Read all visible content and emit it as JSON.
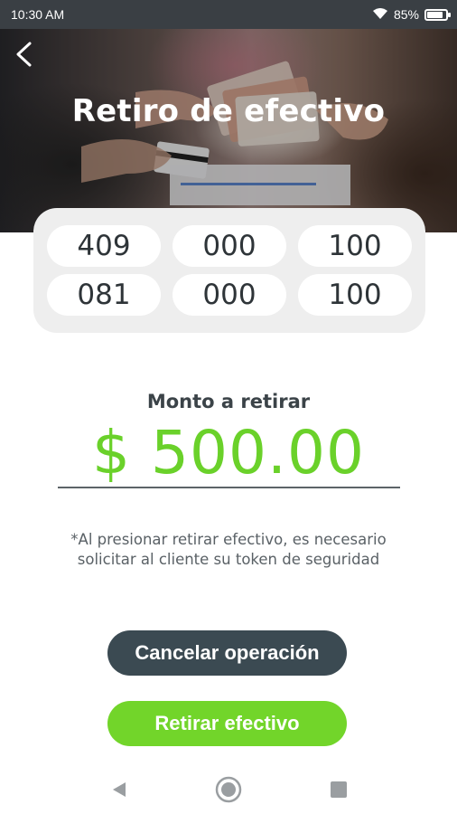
{
  "status_bar": {
    "time": "10:30 AM",
    "battery_percent": "85%",
    "battery_level": 0.85,
    "icons": [
      "wifi-icon",
      "battery-icon"
    ]
  },
  "header": {
    "back_icon": "chevron-left-icon",
    "title": "Retiro de efectivo"
  },
  "account": {
    "groups": [
      "409",
      "000",
      "100",
      "081",
      "000",
      "100"
    ]
  },
  "amount": {
    "label": "Monto a retirar",
    "value": "$ 500.00"
  },
  "disclaimer": {
    "line1": "*Al presionar retirar efectivo, es necesario",
    "line2": "solicitar al cliente su token de seguridad"
  },
  "buttons": {
    "cancel": "Cancelar operación",
    "withdraw": "Retirar efectivo"
  },
  "nav": {
    "icons": [
      "nav-back-icon",
      "nav-home-icon",
      "nav-recent-icon"
    ]
  },
  "colors": {
    "accent_green": "#72d52a",
    "amount_green": "#6ad12a",
    "dark_button": "#3b4a52",
    "status_bar": "#3a3f44"
  }
}
